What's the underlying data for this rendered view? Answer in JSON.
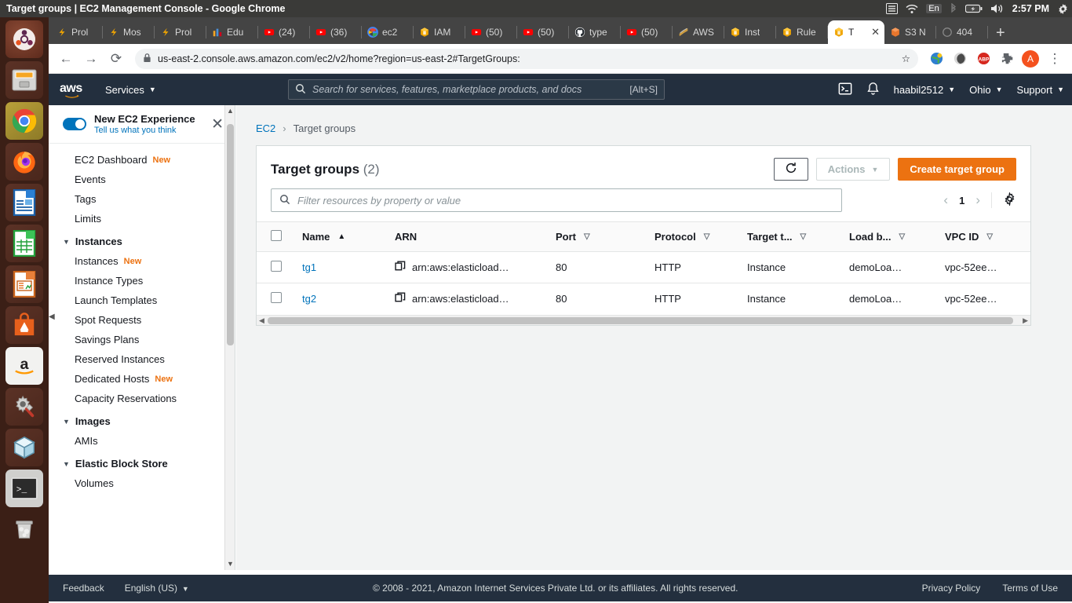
{
  "os": {
    "window_title": "Target groups | EC2 Management Console - Google Chrome",
    "clock": "2:57 PM",
    "keyboard_layout": "En",
    "tray_icons": [
      "menu-list-icon",
      "wifi-icon",
      "keyboard-layout-indicator",
      "bluetooth-icon",
      "battery-icon",
      "volume-icon"
    ],
    "dock_items": [
      {
        "name": "ubuntu-software-center",
        "glyph": "◉"
      },
      {
        "name": "files-manager",
        "glyph": "▤"
      },
      {
        "name": "google-chrome",
        "glyph": "●"
      },
      {
        "name": "firefox",
        "glyph": "◑"
      },
      {
        "name": "libreoffice-writer",
        "glyph": "▤"
      },
      {
        "name": "libreoffice-calc",
        "glyph": "▦"
      },
      {
        "name": "libreoffice-impress",
        "glyph": "▧"
      },
      {
        "name": "ubuntu-software",
        "glyph": "A"
      },
      {
        "name": "amazon-store",
        "glyph": "a"
      },
      {
        "name": "system-settings",
        "glyph": "⚙"
      },
      {
        "name": "virtualbox",
        "glyph": "⬛"
      },
      {
        "name": "terminal",
        "glyph": ">_"
      },
      {
        "name": "trash",
        "glyph": "Ὕ1"
      }
    ]
  },
  "browser": {
    "tabs": [
      {
        "label": "Prol",
        "favicon": "freecodecamp-icon",
        "active": false
      },
      {
        "label": "Mos",
        "favicon": "freecodecamp-icon",
        "active": false
      },
      {
        "label": "Prol",
        "favicon": "freecodecamp-icon",
        "active": false
      },
      {
        "label": "Edu",
        "favicon": "chart-bars-icon",
        "active": false
      },
      {
        "label": "(24)",
        "favicon": "youtube-icon",
        "active": false
      },
      {
        "label": "(36)",
        "favicon": "youtube-icon",
        "active": false
      },
      {
        "label": "ec2",
        "favicon": "google-icon",
        "active": false
      },
      {
        "label": "IAM",
        "favicon": "aws-cube-icon",
        "active": false
      },
      {
        "label": "(50)",
        "favicon": "youtube-icon",
        "active": false
      },
      {
        "label": "(50)",
        "favicon": "youtube-icon",
        "active": false
      },
      {
        "label": "type",
        "favicon": "github-icon",
        "active": false
      },
      {
        "label": "(50)",
        "favicon": "youtube-icon",
        "active": false
      },
      {
        "label": "AWS",
        "favicon": "aws-docs-icon",
        "active": false
      },
      {
        "label": "Inst",
        "favicon": "aws-cube-icon",
        "active": false
      },
      {
        "label": "Rule",
        "favicon": "aws-cube-icon",
        "active": false
      },
      {
        "label": "T",
        "favicon": "aws-cube-icon",
        "active": true
      },
      {
        "label": "S3 N",
        "favicon": "aws-s3-icon",
        "active": false
      },
      {
        "label": "404",
        "favicon": "blank-page-icon",
        "active": false
      }
    ],
    "new_tab_label": "+",
    "url": "us-east-2.console.aws.amazon.com/ec2/v2/home?region=us-east-2#TargetGroups:",
    "back_label": "←",
    "forward_label": "→",
    "reload_label": "⟳",
    "lock_icon": "🔒",
    "star_label": "☆",
    "extensions": [
      "translate-extension-icon",
      "dark-mode-extension-icon",
      "adblock-plus-icon",
      "puzzle-extensions-icon"
    ],
    "profile_initial": "A",
    "menu_label": "⋮"
  },
  "aws_header": {
    "logo": "aws",
    "services_label": "Services",
    "search_placeholder": "Search for services, features, marketplace products, and docs",
    "search_shortcut": "[Alt+S]",
    "cloudshell_icon": "cloudshell-icon",
    "bell_icon": "notifications-bell-icon",
    "account": "haabil2512",
    "region": "Ohio",
    "support": "Support"
  },
  "sidebar": {
    "banner": {
      "title": "New EC2 Experience",
      "subtitle": "Tell us what you think",
      "close_label": "✕"
    },
    "items": [
      {
        "label": "EC2 Dashboard",
        "badge": "New",
        "type": "item"
      },
      {
        "label": "Events",
        "badge": "",
        "type": "item"
      },
      {
        "label": "Tags",
        "badge": "",
        "type": "item"
      },
      {
        "label": "Limits",
        "badge": "",
        "type": "item"
      },
      {
        "label": "Instances",
        "badge": "",
        "type": "group"
      },
      {
        "label": "Instances",
        "badge": "New",
        "type": "item"
      },
      {
        "label": "Instance Types",
        "badge": "",
        "type": "item"
      },
      {
        "label": "Launch Templates",
        "badge": "",
        "type": "item"
      },
      {
        "label": "Spot Requests",
        "badge": "",
        "type": "item"
      },
      {
        "label": "Savings Plans",
        "badge": "",
        "type": "item"
      },
      {
        "label": "Reserved Instances",
        "badge": "",
        "type": "item"
      },
      {
        "label": "Dedicated Hosts",
        "badge": "New",
        "type": "item"
      },
      {
        "label": "Capacity Reservations",
        "badge": "",
        "type": "item"
      },
      {
        "label": "Images",
        "badge": "",
        "type": "group"
      },
      {
        "label": "AMIs",
        "badge": "",
        "type": "item"
      },
      {
        "label": "Elastic Block Store",
        "badge": "",
        "type": "group"
      },
      {
        "label": "Volumes",
        "badge": "",
        "type": "item"
      }
    ]
  },
  "breadcrumb": {
    "root": "EC2",
    "separator": "›",
    "current": "Target groups"
  },
  "panel": {
    "title": "Target groups",
    "count": "(2)",
    "refresh_label": "⟳",
    "actions_label": "Actions",
    "create_label": "Create target group",
    "filter_placeholder": "Filter resources by property or value",
    "page_number": "1",
    "prev_label": "‹",
    "next_label": "›",
    "settings_icon": "gear-icon"
  },
  "table": {
    "columns": [
      {
        "label": "Name",
        "sort": "asc"
      },
      {
        "label": "ARN",
        "sort": "none"
      },
      {
        "label": "Port",
        "sort": "desc"
      },
      {
        "label": "Protocol",
        "sort": "desc"
      },
      {
        "label": "Target t...",
        "sort": "desc"
      },
      {
        "label": "Load b...",
        "sort": "desc"
      },
      {
        "label": "VPC ID",
        "sort": "desc"
      }
    ],
    "rows": [
      {
        "name": "tg1",
        "arn": "arn:aws:elasticload…",
        "port": "80",
        "protocol": "HTTP",
        "target_type": "Instance",
        "load_balancer": "demoLoa…",
        "vpc_id": "vpc-52ee…"
      },
      {
        "name": "tg2",
        "arn": "arn:aws:elasticload…",
        "port": "80",
        "protocol": "HTTP",
        "target_type": "Instance",
        "load_balancer": "demoLoa…",
        "vpc_id": "vpc-52ee…"
      }
    ]
  },
  "aws_footer": {
    "feedback": "Feedback",
    "language": "English (US)",
    "copyright": "© 2008 - 2021, Amazon Internet Services Private Ltd. or its affiliates. All rights reserved.",
    "privacy": "Privacy Policy",
    "terms": "Terms of Use"
  }
}
